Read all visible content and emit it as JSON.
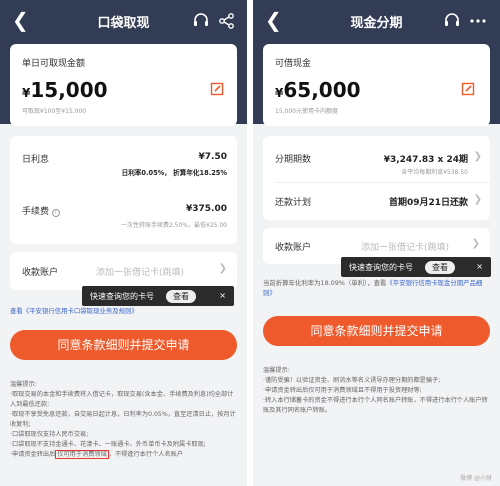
{
  "left": {
    "title": "口袋取现",
    "amount_label": "单日可取现金额",
    "amount_prefix": "¥",
    "amount": "15,000",
    "amount_sub": "可取现¥100至¥15,000",
    "daily_rate_label": "日利息",
    "daily_rate_value": "¥7.50",
    "daily_rate_desc": "日利率0.05%，  折算年化18.25%",
    "fee_label": "手续费",
    "fee_value": "¥375.00",
    "fee_desc": "一次性转账手续费2.50%，最低¥25.00",
    "account_label": "收款账户",
    "account_placeholder": "添加一张借记卡(跳填)",
    "toast_text": "快速查询您的卡号",
    "toast_button": "查看",
    "toast_close": "×",
    "link_text": "查看《平安银行信用卡口袋取现业务及规则》",
    "submit_button": "同意条款细则并提交申请",
    "notes_title": "温馨提示:",
    "notes": [
      "·取现交易的本金和手续费将入借记卡，取现交易(含本金、手续费及利息)均全部计入到最低还款;",
      "·取现不享受免息还款，自交易日起计息，日利率为0.05%，直至还清日止，按月计收复利;",
      "·口袋取现仅支持人民币交易;",
      "·口袋取现不支持金通卡、花漾卡、一账通卡、外币单币卡及附属卡取现;"
    ],
    "last_note_pre": "·申请资金转出后",
    "last_note_boxed": "仅可用于消费领域",
    "last_note_post": "，不得進行本行个人名账户"
  },
  "right": {
    "title": "现金分期",
    "amount_label": "可借现金",
    "amount_prefix": "¥",
    "amount": "65,000",
    "amount_sub": "15,000元使用卡内额度",
    "period_label": "分期期数",
    "period_value": "¥3,247.83 x 24期",
    "period_desc": "含平均每期利息¥538.50",
    "plan_label": "还款计划",
    "plan_value": "首期09月21日还款",
    "account_label": "收款账户",
    "account_placeholder": "添加一张借记卡(跳填)",
    "toast_text": "快速查询您的卡号",
    "toast_button": "查看",
    "toast_close": "×",
    "rate_text": "当前折算年化利率为18.09%（单利），查看",
    "rate_link": "《平安银行信用卡现金分期产品细则》",
    "submit_button": "同意条款细则并提交申请",
    "notes_title": "温馨提示:",
    "notes": [
      "·谨防受骗！以验证资金、刷流水等名义诱导办理分期的都是骗子;",
      "·申请资金转出后仅可用于消费领域且不得用于投资理财等;",
      "·转入本行储蓄卡的资金不得进行本行个人同名账户转账，不得进行本行个人账户转账及其行同名账户转账。"
    ]
  },
  "watermark": "微博 @小财"
}
